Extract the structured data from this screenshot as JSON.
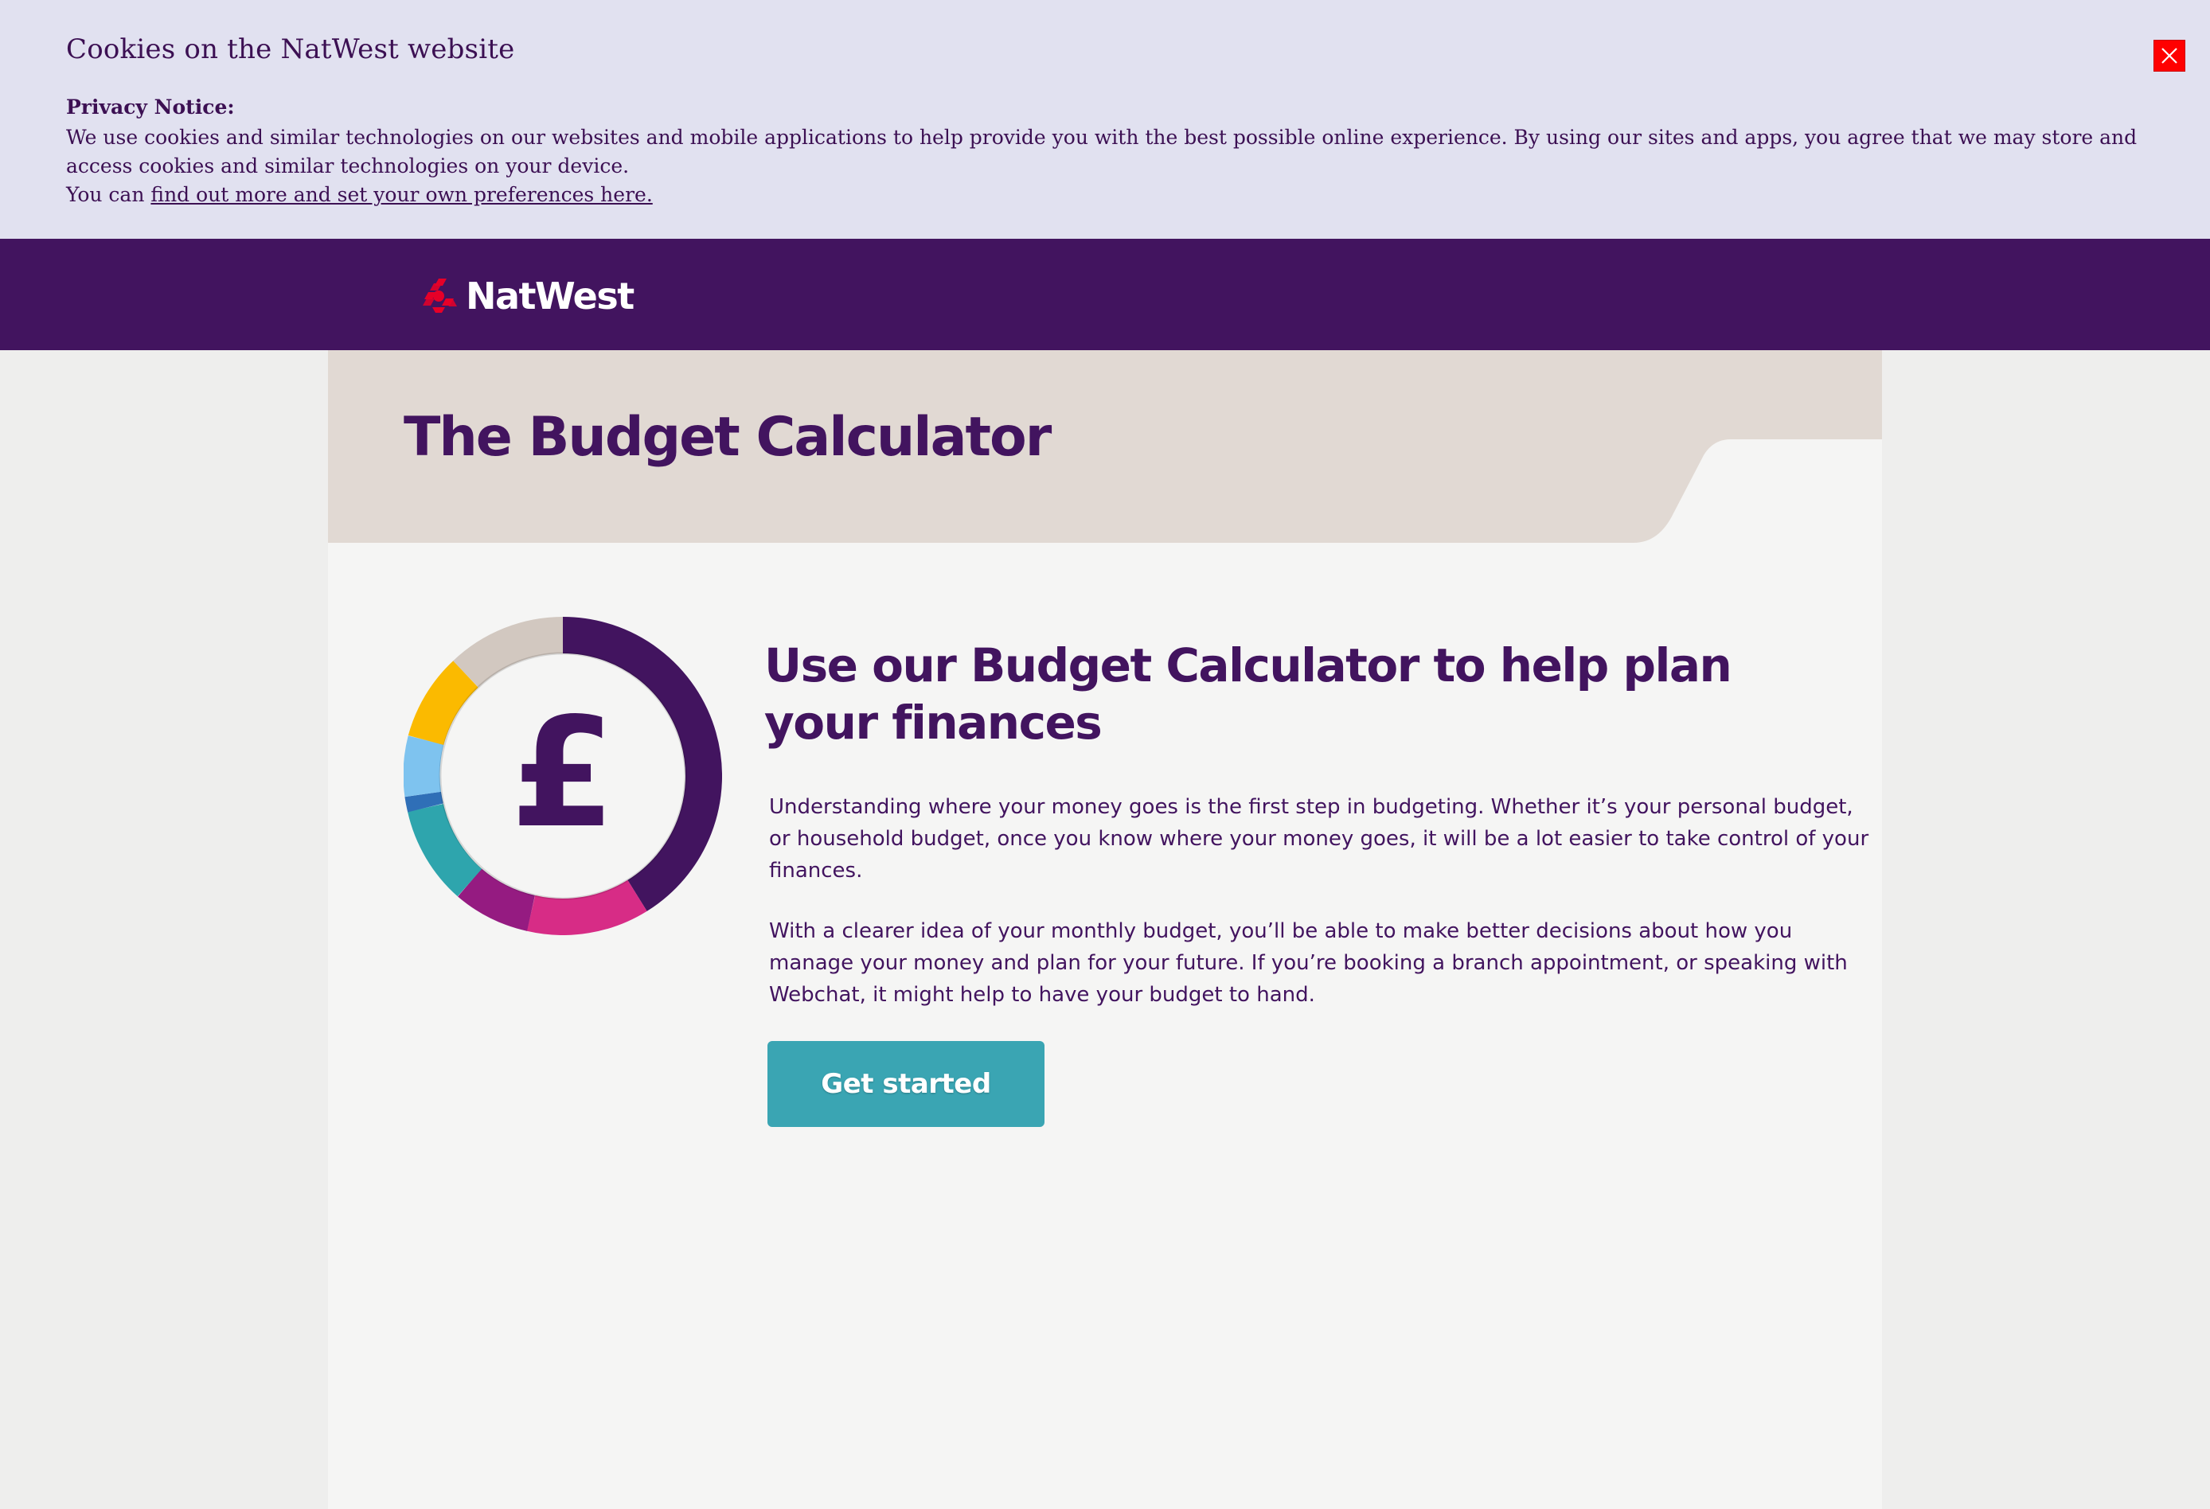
{
  "cookie_banner": {
    "title": "Cookies on the NatWest website",
    "privacy_heading": "Privacy Notice:",
    "body_line1": "We use cookies and similar technologies on our websites and mobile applications to help provide you with the best possible online experience. By using our sites and apps, you agree that we may store and",
    "body_line2": "access cookies and similar technologies on your device.",
    "body_line3_prefix": "You can ",
    "link_text": "find out more and set your own preferences here.",
    "close_icon": "close-icon"
  },
  "header": {
    "brand": "NatWest",
    "logo_icon": "natwest-chevron-logo-icon"
  },
  "hero": {
    "title": "The Budget Calculator"
  },
  "main": {
    "icon": "pound-donut-icon",
    "subtitle": "Use our Budget Calculator to help plan your finances",
    "para1_lines": [
      "Understanding where your money goes is the first step in budgeting.  Whether it’s your personal budget,",
      "or household budget, once you know where your money goes, it will be a lot easier to take control of your",
      "finances."
    ],
    "para2_lines": [
      "With a clearer idea of your monthly budget, you’ll be able to make better decisions about how you",
      "manage your money and plan for your future. If you’re booking a branch appointment, or speaking with",
      "Webchat, it might help to have your budget to hand."
    ],
    "cta_label": "Get started"
  },
  "colors": {
    "brand_purple": "#42145f",
    "banner_bg": "#e1e1f0",
    "hero_band": "#e1d9d3",
    "cta_teal": "#3aa5b3",
    "close_red": "#ff0000",
    "logo_red": "#e60028"
  }
}
